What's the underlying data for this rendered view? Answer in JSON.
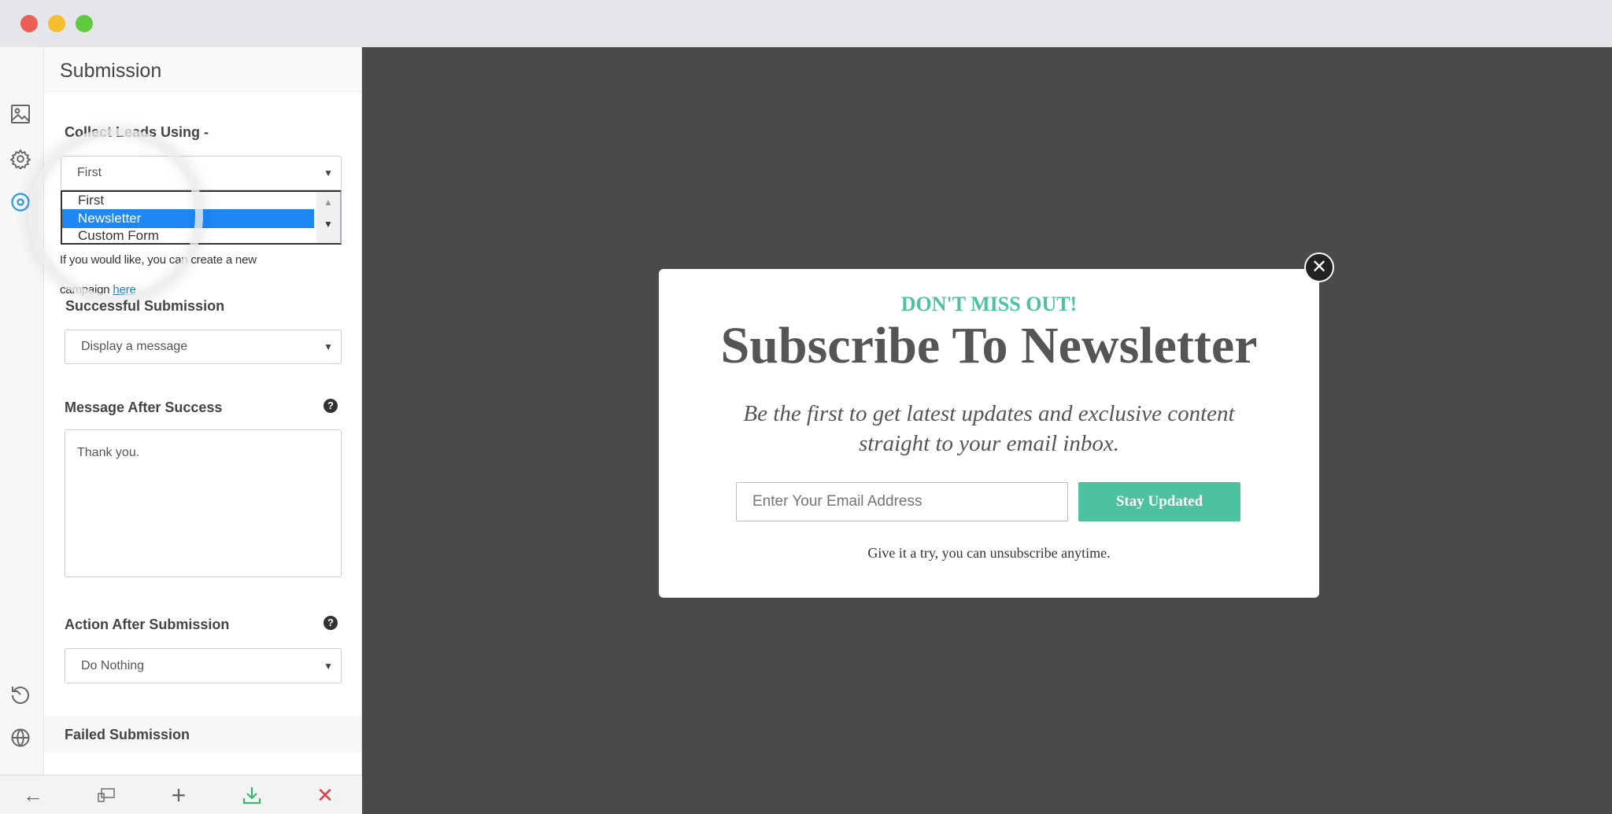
{
  "window": {
    "controls": [
      "close",
      "minimize",
      "maximize"
    ]
  },
  "rail": {
    "icons": [
      "image-icon",
      "gear-icon",
      "target-icon",
      "history-icon",
      "globe-icon"
    ]
  },
  "panel": {
    "title": "Submission",
    "collect_label": "Collect Leads Using -",
    "collect_value": "First",
    "collect_options": [
      "First",
      "Newsletter",
      "Custom Form"
    ],
    "collect_highlighted": "Newsletter",
    "help_text": "If you would like, you can create a new campaign ",
    "help_link": "here",
    "success_label": "Successful Submission",
    "success_value": "Display a message",
    "message_label": "Message After Success",
    "message_value": "Thank you.",
    "action_label": "Action After Submission",
    "action_value": "Do Nothing",
    "failed_label": "Failed Submission",
    "help_icon": "?"
  },
  "bottombar": {
    "icons": [
      "back-arrow-icon",
      "devices-icon",
      "plus-icon",
      "download-icon",
      "close-icon"
    ],
    "accent_save": "#3cb371",
    "accent_close": "#e04040"
  },
  "popup": {
    "eyebrow": "DON'T MISS OUT!",
    "title": "Subscribe To Newsletter",
    "subtitle_line1": "Be the first to get latest updates and exclusive content",
    "subtitle_line2": "straight to your email inbox.",
    "email_placeholder": "Enter Your Email Address",
    "button_label": "Stay Updated",
    "footer": "Give it a try, you can unsubscribe anytime.",
    "accent": "#4dc2a1"
  }
}
